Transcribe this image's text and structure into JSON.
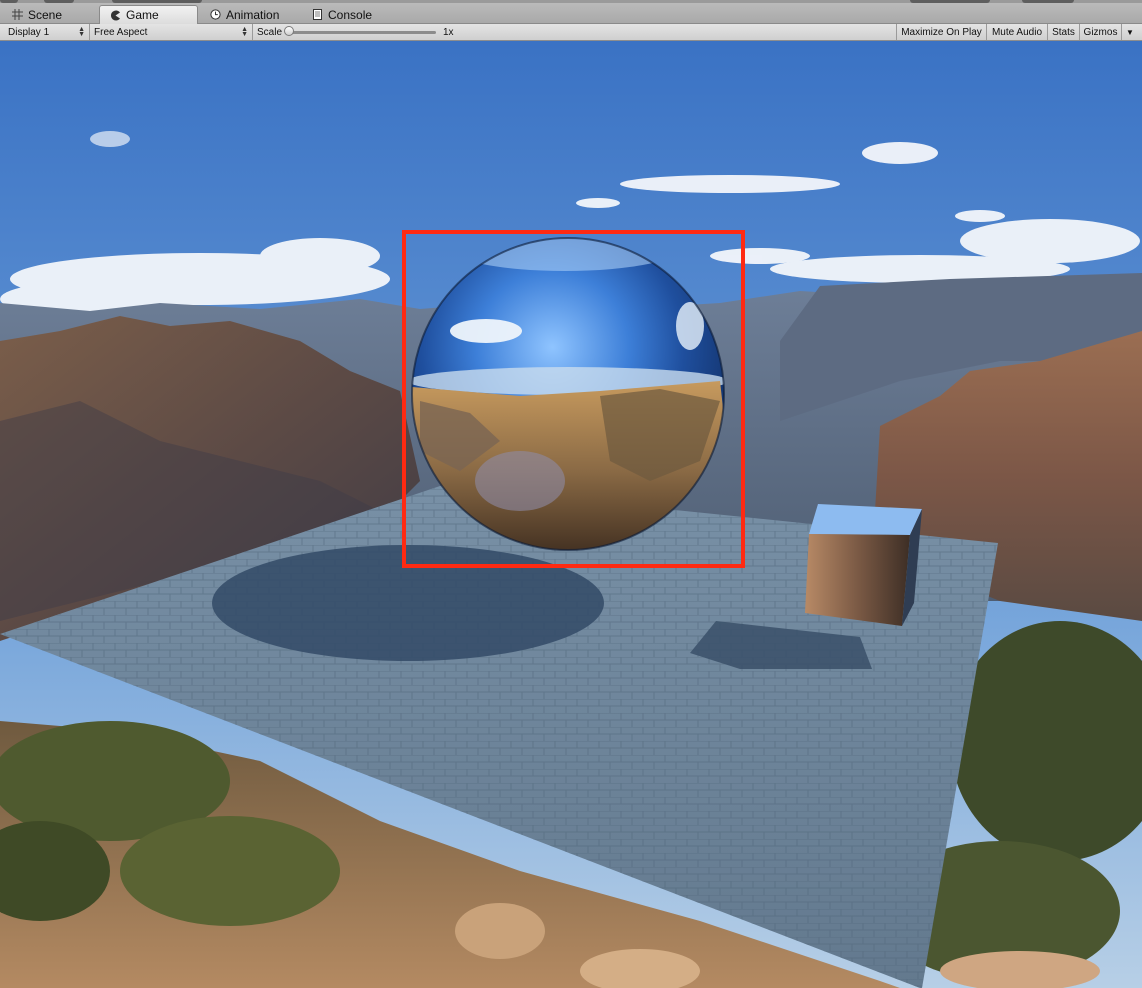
{
  "tabs": [
    {
      "label": "Scene",
      "icon": "grid-icon",
      "active": false
    },
    {
      "label": "Game",
      "icon": "pacman-icon",
      "active": true
    },
    {
      "label": "Animation",
      "icon": "clock-icon",
      "active": false
    },
    {
      "label": "Console",
      "icon": "document-icon",
      "active": false
    }
  ],
  "toolbar": {
    "display": "Display 1",
    "aspect": "Free Aspect",
    "scale_label": "Scale",
    "scale_value": "1x",
    "maximize": "Maximize On Play",
    "mute": "Mute Audio",
    "stats": "Stats",
    "gizmos": "Gizmos"
  },
  "colors": {
    "highlight": "#ff2a12",
    "sky_top": "#3f78c8",
    "floor": "#6b8399"
  }
}
